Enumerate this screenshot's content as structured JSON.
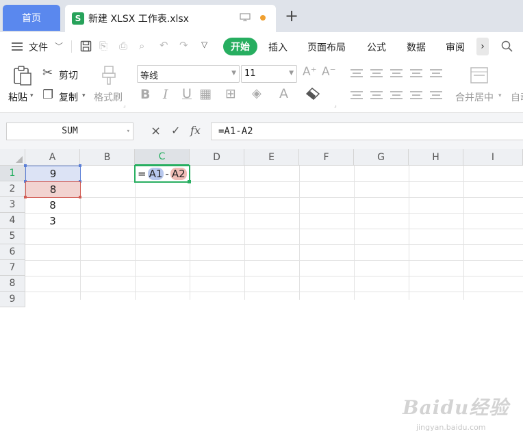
{
  "tabs": {
    "home_label": "首页",
    "doc_icon": "S",
    "doc_title": "新建 XLSX 工作表.xlsx",
    "add": "+"
  },
  "menu": {
    "file_label": "文件",
    "start_label": "开始",
    "items": [
      "插入",
      "页面布局",
      "公式",
      "数据",
      "审阅"
    ],
    "more": "›"
  },
  "ribbon": {
    "paste": "粘贴",
    "cut": "剪切",
    "copy": "复制",
    "format_painter": "格式刷",
    "font_name": "等线",
    "font_size": "11",
    "bold": "B",
    "italic": "I",
    "underline": "U",
    "merge_center": "合并居中",
    "wrap_partial": "自动"
  },
  "formula_bar": {
    "name_box": "SUM",
    "cancel": "×",
    "confirm": "✓",
    "fx": "fx",
    "formula": "=A1-A2"
  },
  "grid": {
    "columns": [
      "A",
      "B",
      "C",
      "D",
      "E",
      "F",
      "G",
      "H",
      "I"
    ],
    "rows": [
      "1",
      "2",
      "3",
      "4",
      "5",
      "6",
      "7",
      "8",
      "9"
    ],
    "values": {
      "A1": "9",
      "A2": "8",
      "A3": "8",
      "A4": "3"
    },
    "editing_cell": {
      "prefix": "=",
      "ref1": "A1",
      "op": "-",
      "ref2": "A2"
    }
  },
  "colors": {
    "accent_green": "#27ae60",
    "home_tab_blue": "#5a88ee",
    "ref1_blue": "#5b7fd6",
    "ref2_red": "#d15a52"
  },
  "watermark": {
    "main": "Baidu经验",
    "sub": "jingyan.baidu.com"
  }
}
